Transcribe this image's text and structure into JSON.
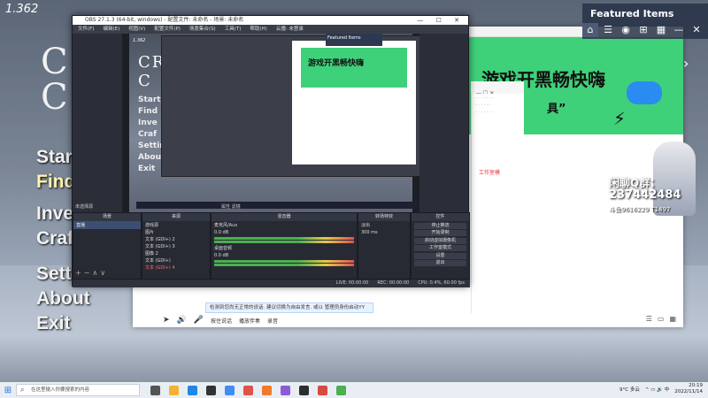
{
  "game": {
    "version": "1.362",
    "logo": "CR\nC",
    "menu": [
      "Start",
      "Find",
      "Inve",
      "Craf",
      "Settings",
      "About",
      "Exit"
    ]
  },
  "featured": {
    "title": "Featured Items",
    "icons": [
      "home-icon",
      "list-icon",
      "gamepad-icon",
      "cart-icon",
      "grid-icon",
      "minimize-icon",
      "close-icon"
    ]
  },
  "banner": {
    "title": "游戏开黑畅快嗨",
    "subtitle": "具”"
  },
  "stream_card": {
    "qq_label": "闲聊Q群：",
    "qq_number": "237442484",
    "sub": "斗鱼9616229 T1497"
  },
  "side_panel": {
    "mode_label": "工作室模"
  },
  "notice": {
    "text": "检测到您尚无正常的说话. 建议切换为自由发言. 或以 管理员身份启动YY"
  },
  "chat_toolbar": {
    "buttons": [
      "按住说话",
      "播放伴奏",
      "录音"
    ]
  },
  "obs": {
    "title": "OBS 27.1.3 (64-bit, windows) - 配置文件: 未命名 - 场景: 未命名",
    "menu": [
      "文件(F)",
      "编辑(E)",
      "视图(V)",
      "配置文件(P)",
      "场景集合(S)",
      "工具(T)",
      "帮助(H)",
      "云播: 未登录"
    ],
    "window_controls": "— ☐ ✕",
    "preview": {
      "version": "1.362",
      "logo": "CR\nC",
      "menu": [
        "Start",
        "Find",
        "Inve",
        "Craf",
        "Settings",
        "About",
        "Exit"
      ],
      "banner": "游戏开黑畅快嗨",
      "featured": "Featured Items"
    },
    "scene_label": "未选择源",
    "transition_label": "属性  滤镜",
    "docks": {
      "scenes": {
        "title": "场景",
        "items": [
          "直播"
        ]
      },
      "sources": {
        "title": "来源",
        "items": [
          "游戏源",
          "图片",
          "文本 (GDI+) 2",
          "文本 (GDI+) 3",
          "图像 2",
          "文本 (GDI+)",
          "文本 (GDI+) 4"
        ]
      },
      "mixer": {
        "title": "混音器",
        "channels": [
          {
            "name": "麦克风/Aux",
            "value": "0.0 dB"
          },
          {
            "name": "桌面音频",
            "value": "0.0 dB"
          }
        ]
      },
      "transitions": {
        "title": "转场特效",
        "value": "淡出",
        "duration": "300 ms"
      },
      "controls": {
        "title": "控件",
        "buttons": [
          "停止推流",
          "开始录制",
          "启动虚拟摄像机",
          "工作室模式",
          "设置",
          "退出"
        ]
      }
    },
    "status": [
      "LIVE: 00:00:00",
      "REC: 00:00:00",
      "CPU: 0.4%, 60.00 fps"
    ]
  },
  "taskbar": {
    "search_placeholder": "在这里输入你要搜索的内容",
    "weather": "9°C 多云",
    "time": "20:19",
    "date": "2022/11/14"
  },
  "colors": {
    "banner_green": "#3fd07a",
    "obs_bg": "#2b2e38",
    "accent_blue": "#1a73e8"
  }
}
